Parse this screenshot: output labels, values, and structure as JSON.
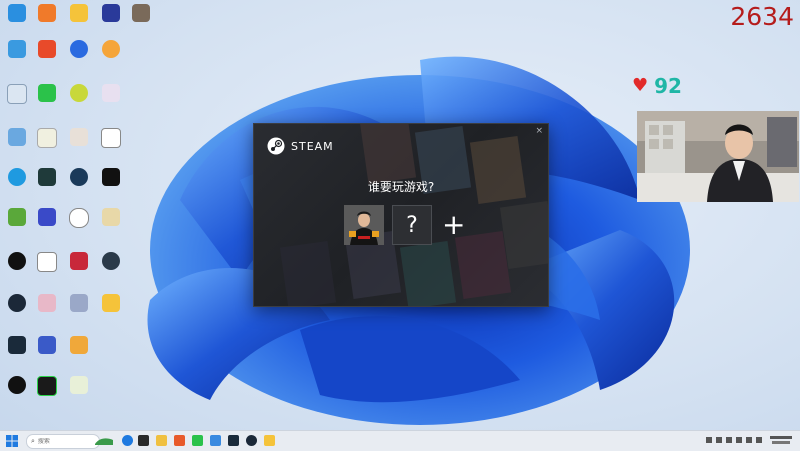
{
  "overlay": {
    "counter": "2634",
    "likes": "92",
    "heart_color": "#e22a2a",
    "likes_color": "#1fb6a6"
  },
  "steam_dialog": {
    "brand": "STEAM",
    "prompt": "谁要玩游戏?",
    "unknown_slot": "?",
    "add_slot": "+",
    "close": "×"
  },
  "taskbar": {
    "search_placeholder": "搜索"
  },
  "colors": {
    "counter": "#b51c1c",
    "steam_bg": "#1f2125",
    "taskbar": "#e8ecf2",
    "wallpaper_blue": "#1f56d6"
  },
  "icons": [
    "start-icon",
    "search-icon",
    "taskview-icon",
    "edge-icon",
    "explorer-icon",
    "steam-icon",
    "wechat-icon",
    "recycle-bin-icon"
  ]
}
